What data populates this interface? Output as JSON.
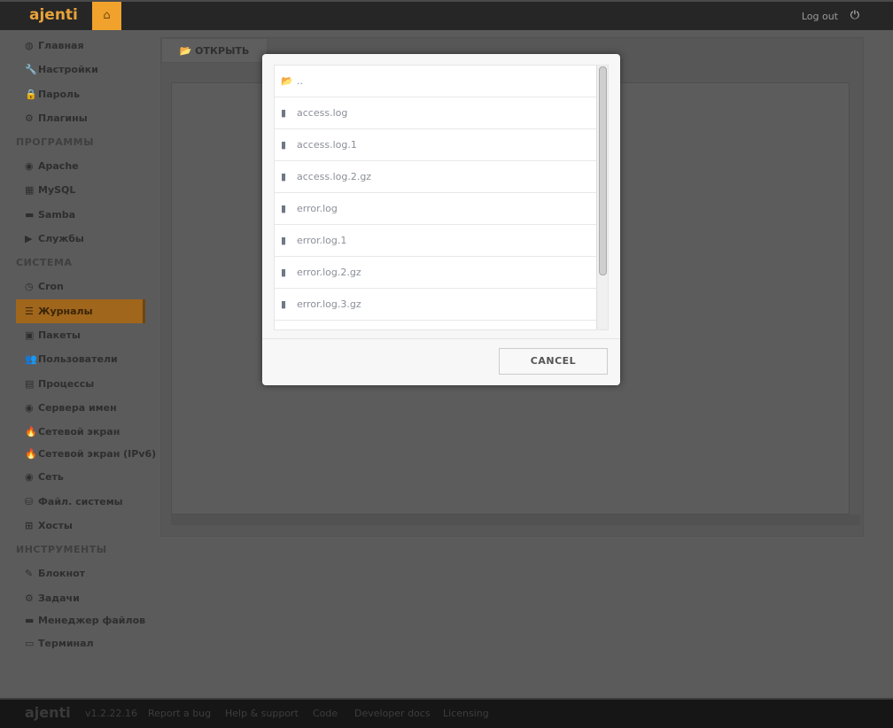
{
  "header": {
    "logo": "ajenti",
    "home_icon": "home-icon",
    "logout": "Log out"
  },
  "sidebar": {
    "items": [
      {
        "type": "item",
        "icon": "◍",
        "label": "Главная"
      },
      {
        "type": "item",
        "icon": "🔧",
        "label": "Настройки"
      },
      {
        "type": "item",
        "icon": "🔒",
        "label": "Пароль"
      },
      {
        "type": "item",
        "icon": "⚙",
        "label": "Плагины"
      },
      {
        "type": "sec",
        "label": "ПРОГРАММЫ"
      },
      {
        "type": "item",
        "icon": "◉",
        "label": "Apache"
      },
      {
        "type": "item",
        "icon": "▦",
        "label": "MySQL"
      },
      {
        "type": "item",
        "icon": "▬",
        "label": "Samba"
      },
      {
        "type": "item",
        "icon": "▶",
        "label": "Службы"
      },
      {
        "type": "sec",
        "label": "СИСТЕМА"
      },
      {
        "type": "item",
        "icon": "◷",
        "label": "Cron"
      },
      {
        "type": "item",
        "icon": "☰",
        "label": "Журналы",
        "active": true
      },
      {
        "type": "item",
        "icon": "▣",
        "label": "Пакеты"
      },
      {
        "type": "item",
        "icon": "👥",
        "label": "Пользователи"
      },
      {
        "type": "item",
        "icon": "▤",
        "label": "Процессы"
      },
      {
        "type": "item",
        "icon": "◉",
        "label": "Сервера имен"
      },
      {
        "type": "item",
        "icon": "🔥",
        "label": "Сетевой экран"
      },
      {
        "type": "item",
        "icon": "🔥",
        "label": "Сетевой экран (IPv6)",
        "wrap": true
      },
      {
        "type": "item",
        "icon": "◉",
        "label": "Сеть"
      },
      {
        "type": "item",
        "icon": "⛁",
        "label": "Файл. системы"
      },
      {
        "type": "item",
        "icon": "⊞",
        "label": "Хосты"
      },
      {
        "type": "sec",
        "label": "ИНСТРУМЕНТЫ"
      },
      {
        "type": "item",
        "icon": "✎",
        "label": "Блокнот"
      },
      {
        "type": "item",
        "icon": "⚙",
        "label": "Задачи"
      },
      {
        "type": "item",
        "icon": "▬",
        "label": "Менеджер файлов",
        "wrap": true
      },
      {
        "type": "item",
        "icon": "▭",
        "label": "Терминал"
      }
    ]
  },
  "main": {
    "open_button": "ОТКРЫТЬ"
  },
  "dialog": {
    "files": [
      {
        "name": "..",
        "icon": "folder-open-icon"
      },
      {
        "name": "access.log",
        "icon": "file-icon"
      },
      {
        "name": "access.log.1",
        "icon": "file-icon"
      },
      {
        "name": "access.log.2.gz",
        "icon": "file-icon"
      },
      {
        "name": "error.log",
        "icon": "file-icon"
      },
      {
        "name": "error.log.1",
        "icon": "file-icon"
      },
      {
        "name": "error.log.2.gz",
        "icon": "file-icon"
      },
      {
        "name": "error.log.3.gz",
        "icon": "file-icon"
      },
      {
        "name": "",
        "icon": "file-icon"
      }
    ],
    "cancel": "CANCEL"
  },
  "footer": {
    "logo": "ajenti",
    "version": "v1.2.22.16",
    "links": [
      "Report a bug",
      "Help & support",
      "Code",
      "Developer docs",
      "Licensing"
    ]
  }
}
